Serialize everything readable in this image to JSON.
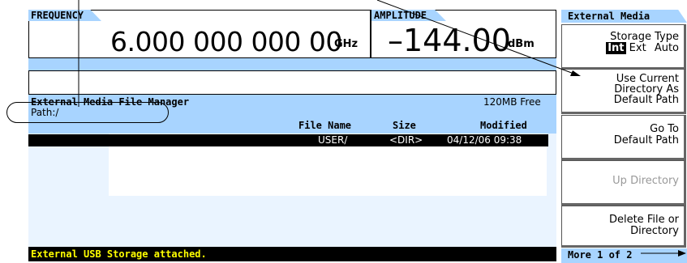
{
  "header": {
    "frequency_label": "FREQUENCY",
    "frequency_value": "6.000 000 000 00",
    "frequency_unit": "GHz",
    "amplitude_label": "AMPLITUDE",
    "amplitude_value": "–144.00",
    "amplitude_unit": "dBm"
  },
  "file_manager": {
    "title": "External Media File Manager",
    "free_space": "120MB Free",
    "path": "Path:/",
    "columns": {
      "name": "File Name",
      "size": "Size",
      "modified": "Modified"
    },
    "rows": [
      {
        "name": "USER/",
        "size": "<DIR>",
        "modified": "04/12/06 09:38"
      }
    ]
  },
  "status": {
    "message": "External USB Storage attached."
  },
  "softkeys": {
    "menu_title": "External Media",
    "storage_type": {
      "label": "Storage Type",
      "options": [
        "Int",
        "Ext",
        "Auto"
      ],
      "selected": "Int"
    },
    "use_current_dir": [
      "Use Current",
      "Directory As",
      "Default Path"
    ],
    "go_to_default": [
      "Go To",
      "Default Path"
    ],
    "up_directory": "Up Directory",
    "delete_file": [
      "Delete File or",
      "Directory"
    ],
    "more": "More 1 of 2"
  },
  "colors": {
    "panel_blue": "#a8d4ff",
    "status_bg": "#000000",
    "status_text": "#ffff00"
  }
}
